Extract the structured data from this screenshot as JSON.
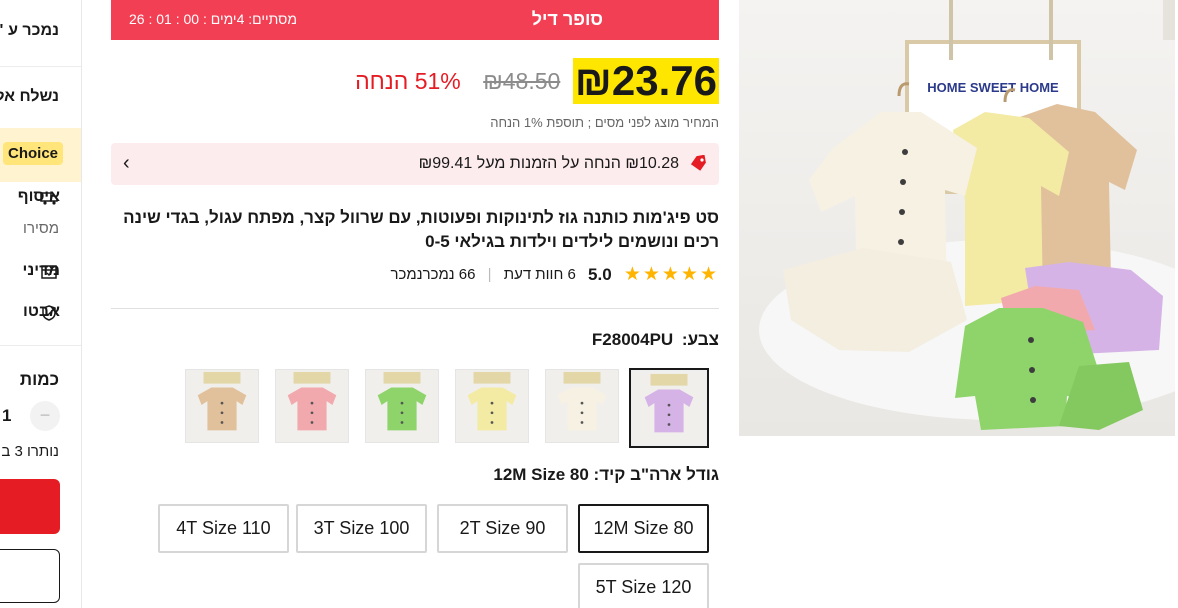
{
  "sidebar": {
    "sold_by": "נמכר ע \"",
    "ship_from": "נשלח אל",
    "choice_badge": "Choice",
    "features": [
      {
        "label": "איסוף",
        "icon": "truck-icon"
      },
      {
        "label": "מדיני",
        "icon": "return-icon"
      },
      {
        "label": "אבטו",
        "icon": "shield-icon"
      }
    ],
    "feature_sub": "מסירו",
    "quantity_label": "כמות",
    "quantity_value": "1",
    "quantity_minus": "−",
    "remaining": "נותרו 3 ב"
  },
  "deal": {
    "title": "סופר דיל",
    "ends_label": "מסתיים:",
    "ends_value": "4ימים : 00 : 01 : 26"
  },
  "price": {
    "current": "₪23.76",
    "original": "₪48.50",
    "discount": "51% הנחה",
    "tax_note": "המחיר מוצג לפני מסים ; תוספת 1% הנחה"
  },
  "coupon": {
    "text": "₪10.28 הנחה על הזמנות מעל ₪99.41",
    "icon": "tag-icon",
    "chevron": "‹"
  },
  "product": {
    "title": "סט פיג'מות כותנה גוז לתינוקות ופעוטות, עם שרוול קצר, מפתח עגול, בגדי שינה רכים ונושמים לילדים וילדות בגילאי 0-5",
    "stars": "★★★★★",
    "score": "5.0",
    "reviews": "6 חוות דעת",
    "sold": "66 נמכרנמכר"
  },
  "color": {
    "label": "צבע:",
    "value": "F28004PU",
    "swatches": [
      {
        "name": "purple",
        "shirt": "#d6b3e6",
        "selected": true
      },
      {
        "name": "white",
        "shirt": "#f6f1e2",
        "selected": false
      },
      {
        "name": "yellow",
        "shirt": "#f3eaa4",
        "selected": false
      },
      {
        "name": "green",
        "shirt": "#8fd46a",
        "selected": false
      },
      {
        "name": "pink",
        "shirt": "#f2a9ad",
        "selected": false
      },
      {
        "name": "khaki",
        "shirt": "#e0c19c",
        "selected": false
      }
    ]
  },
  "size": {
    "label": "גודל ארה\"ב קיד:",
    "value": "12M Size 80",
    "options": [
      "12M Size 80",
      "2T Size 90",
      "3T Size 100",
      "4T Size 110",
      "5T Size 120"
    ]
  },
  "gallery": {
    "sign_text": "HOME SWEET HOME"
  },
  "colors": {
    "deal_red": "#f23f53",
    "price_highlight": "#ffe600",
    "discount_red": "#e51c23",
    "coupon_bg": "#fdeced",
    "star": "#ffb400",
    "choice_bg": "#ffe57a"
  }
}
